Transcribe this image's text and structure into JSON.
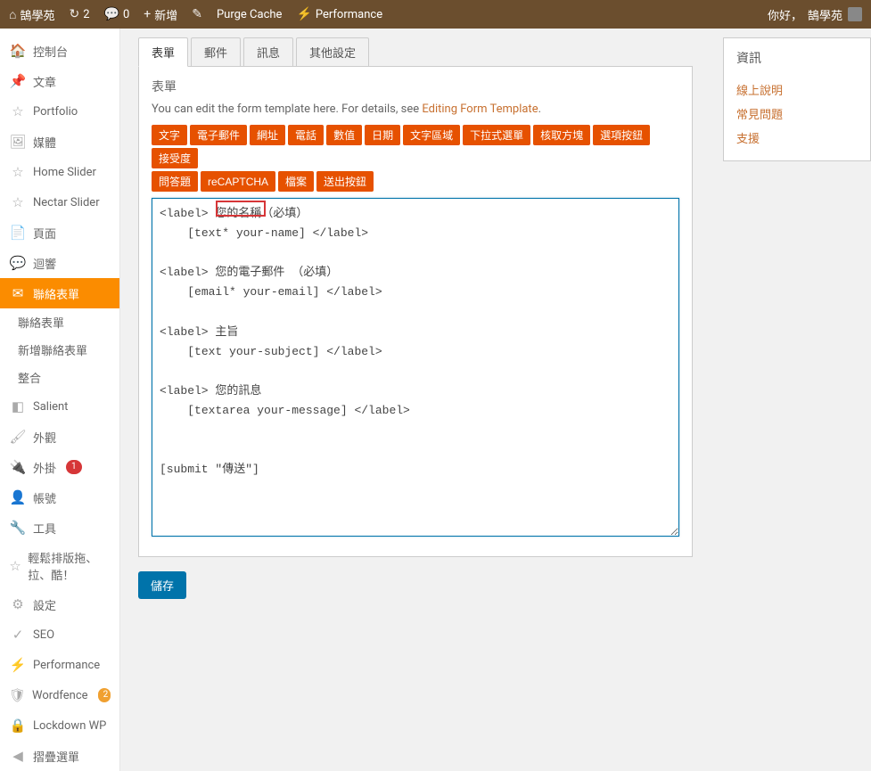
{
  "adminbar": {
    "site_name": "鵠學苑",
    "updates_count": "2",
    "comments_count": "0",
    "new_label": "新增",
    "purge_label": "Purge Cache",
    "performance_label": "Performance",
    "greeting_prefix": "你好，",
    "greeting_name": "鵠學苑"
  },
  "sidebar": {
    "items": [
      {
        "icon": "speedometer",
        "label": "控制台"
      },
      {
        "icon": "pin",
        "label": "文章"
      },
      {
        "icon": "star",
        "label": "Portfolio"
      },
      {
        "icon": "media",
        "label": "媒體"
      },
      {
        "icon": "star",
        "label": "Home Slider"
      },
      {
        "icon": "star",
        "label": "Nectar Slider"
      },
      {
        "icon": "page",
        "label": "頁面"
      },
      {
        "icon": "comment",
        "label": "迴響"
      },
      {
        "icon": "mail",
        "label": "聯絡表單",
        "current": true
      },
      {
        "icon": "salient",
        "label": "Salient"
      },
      {
        "icon": "brush",
        "label": "外觀"
      },
      {
        "icon": "plug",
        "label": "外掛",
        "badge": "1",
        "badge_color": "red"
      },
      {
        "icon": "user",
        "label": "帳號"
      },
      {
        "icon": "wrench",
        "label": "工具"
      },
      {
        "icon": "star",
        "label": "輕鬆排版拖、拉、酷！"
      },
      {
        "icon": "settings",
        "label": "設定"
      },
      {
        "icon": "seo",
        "label": "SEO"
      },
      {
        "icon": "perf",
        "label": "Performance"
      },
      {
        "icon": "wf",
        "label": "Wordfence",
        "badge": "2",
        "badge_color": "orange"
      },
      {
        "icon": "lock",
        "label": "Lockdown WP"
      },
      {
        "icon": "collapse",
        "label": "摺疊選單"
      }
    ],
    "submenu": [
      {
        "label": "聯絡表單"
      },
      {
        "label": "新增聯絡表單"
      },
      {
        "label": "整合"
      }
    ]
  },
  "tabs": [
    {
      "label": "表單",
      "active": true
    },
    {
      "label": "郵件"
    },
    {
      "label": "訊息"
    },
    {
      "label": "其他設定"
    }
  ],
  "panel": {
    "title": "表單",
    "desc_before": "You can edit the form template here. For details, see ",
    "desc_link": "Editing Form Template",
    "desc_after": "."
  },
  "tags_row1": [
    "文字",
    "電子郵件",
    "網址",
    "電話",
    "數值",
    "日期",
    "文字區域",
    "下拉式選單",
    "核取方塊",
    "選項按鈕",
    "接受度"
  ],
  "tags_row2": [
    "問答題",
    "reCAPTCHA",
    "檔案",
    "送出按鈕"
  ],
  "form_template": "<label> 您的名稱（必填）\n    [text* your-name] </label>\n\n<label> 您的電子郵件 （必填）\n    [email* your-email] </label>\n\n<label> 主旨\n    [text your-subject] </label>\n\n<label> 您的訊息\n    [textarea your-message] </label>\n\n\n[submit \"傳送\"]",
  "save_button": "儲存",
  "right_panel": {
    "title": "資訊",
    "links": [
      "線上說明",
      "常見問題",
      "支援"
    ]
  }
}
